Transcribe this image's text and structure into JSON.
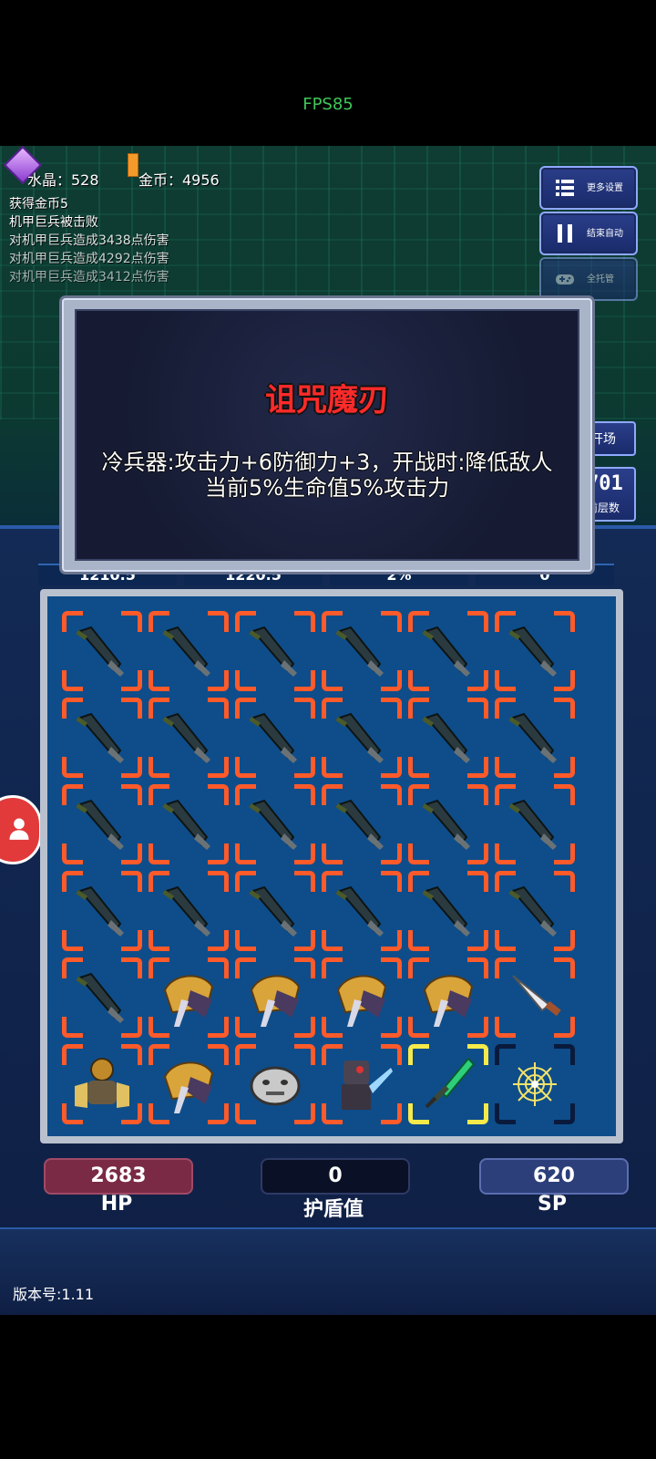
{
  "fps": "FPS85",
  "resources": {
    "crystal": "水晶：528",
    "gold": "金币：4956"
  },
  "log": [
    "获得金币5",
    "机甲巨兵被击败",
    "对机甲巨兵造成3438点伤害",
    "对机甲巨兵造成4292点伤害",
    "对机甲巨兵造成3412点伤害"
  ],
  "buttons": {
    "more_settings": "更多设置",
    "end_auto": "结束自动",
    "full_auto": "全托管"
  },
  "side": {
    "start": "开场",
    "floor_number": "701",
    "floor_label": "前层数"
  },
  "popup": {
    "title": "诅咒魔刃",
    "description": "冷兵器:攻击力+6防御力+3，开战时:降低敌人当前5%生命值5%攻击力"
  },
  "stats": [
    "1210.5",
    "1220.5",
    "2%",
    "0"
  ],
  "inventory": {
    "rows": [
      [
        "cursed-blade",
        "cursed-blade",
        "cursed-blade",
        "cursed-blade",
        "cursed-blade",
        "cursed-blade"
      ],
      [
        "cursed-blade",
        "cursed-blade",
        "cursed-blade",
        "cursed-blade",
        "cursed-blade",
        "cursed-blade"
      ],
      [
        "cursed-blade",
        "cursed-blade",
        "cursed-blade",
        "cursed-blade",
        "cursed-blade",
        "cursed-blade"
      ],
      [
        "cursed-blade",
        "cursed-blade",
        "cursed-blade",
        "cursed-blade",
        "cursed-blade",
        "cursed-blade"
      ],
      [
        "cursed-blade",
        "gold-gauntlet",
        "gold-gauntlet",
        "gold-gauntlet",
        "gold-gauntlet",
        "kitchen-knife"
      ],
      [
        "mech-warrior",
        "gold-gauntlet",
        "stone-mask",
        "dark-knight",
        "jade-sword",
        "golden-web"
      ]
    ]
  },
  "player": {
    "hp_value": "2683",
    "hp_label": "HP",
    "shield_value": "0",
    "shield_label": "护盾值",
    "sp_value": "620",
    "sp_label": "SP"
  },
  "version": "版本号:1.11",
  "colors": {
    "accent": "#ff5a2a",
    "title_red": "#ff2a2a",
    "fps_green": "#3fc85a"
  }
}
